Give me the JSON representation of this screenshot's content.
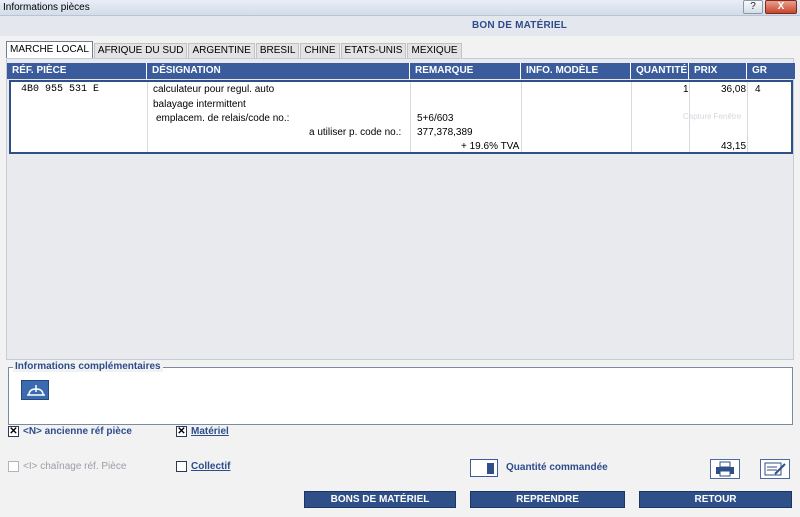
{
  "window": {
    "title": "Informations pièces",
    "help_label": "?",
    "close_label": "X"
  },
  "page": {
    "title": "BON DE MATÉRIEL"
  },
  "tabs": [
    {
      "label": "MARCHE LOCAL",
      "active": true
    },
    {
      "label": "AFRIQUE DU SUD",
      "active": false
    },
    {
      "label": "ARGENTINE",
      "active": false
    },
    {
      "label": "BRESIL",
      "active": false
    },
    {
      "label": "CHINE",
      "active": false
    },
    {
      "label": "ETATS-UNIS",
      "active": false
    },
    {
      "label": "MEXIQUE",
      "active": false
    }
  ],
  "table": {
    "columns": [
      "RÉF. PIÈCE",
      "DÉSIGNATION",
      "REMARQUE",
      "INFO. MODÈLE",
      "QUANTITÉ",
      "PRIX",
      "GR"
    ],
    "row": {
      "ref": "4B0 955 531 E",
      "designation_lines": [
        "calculateur pour regul. auto",
        "balayage intermittent",
        "emplacem. de relais/code no.:",
        "a utiliser p. code no.:",
        "+ 19.6% TVA"
      ],
      "remarque_lines": [
        "5+6/603",
        "377,378,389"
      ],
      "quantite": "1",
      "prix": "36,08",
      "prix_ttc": "43,15",
      "gr": "4"
    },
    "watermark": "Capture Fenêtre"
  },
  "info": {
    "title": "Informations complémentaires",
    "icon": "expand-icon"
  },
  "options": {
    "ancienne_ref": {
      "label": "<N> ancienne réf pièce",
      "checked": true
    },
    "materiel": {
      "label": "Matériel",
      "checked": true
    },
    "chainage_ref": {
      "label": "<I> chaînage réf. Pièce",
      "checked": false
    },
    "collectif": {
      "label": "Collectif",
      "checked": false
    }
  },
  "quantity": {
    "value": "",
    "label": "Quantité commandée"
  },
  "buttons": {
    "bons_materiel": "BONS DE MATÉRIEL",
    "reprendre": "REPRENDRE",
    "retour": "RETOUR"
  },
  "colors": {
    "accent": "#2f4f88",
    "header": "#3a5c9c",
    "label": "#2c4c8c"
  }
}
